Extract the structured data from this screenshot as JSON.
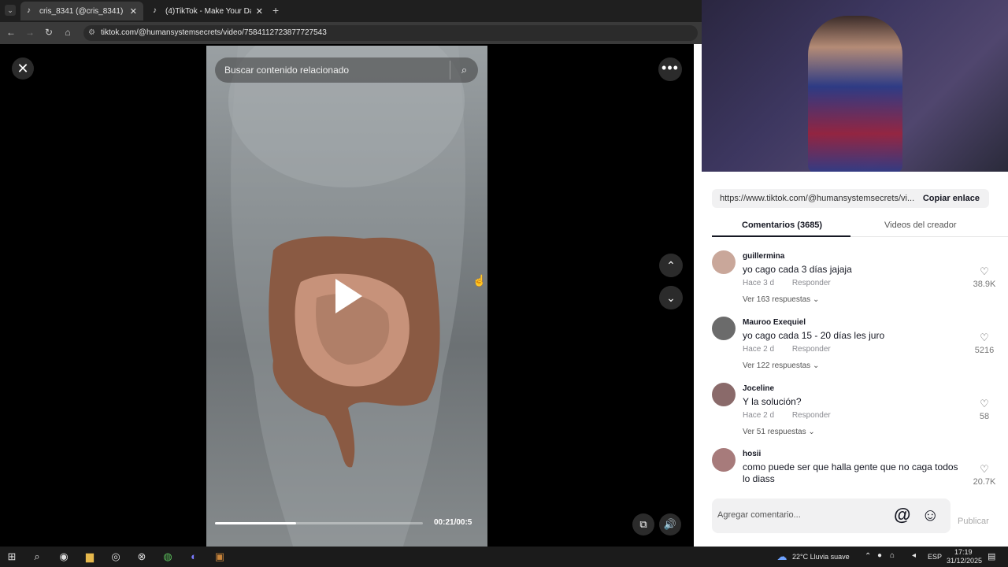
{
  "browser": {
    "tabs": [
      {
        "title": "cris_8341 (@cris_8341) | TikTok",
        "active": true
      },
      {
        "title": "(4)TikTok - Make Your Day",
        "active": false
      }
    ],
    "url": "tiktok.com/@humansystemsecrets/video/7584112723877727543"
  },
  "video": {
    "search_placeholder": "Buscar contenido relacionado",
    "time": "00:21/00:5",
    "progress": 0.39
  },
  "share": {
    "link": "https://www.tiktok.com/@humansystemsecrets/vi...",
    "copy_label": "Copiar enlace"
  },
  "tabs": {
    "comments": "Comentarios (3685)",
    "creator": "Videos del creador"
  },
  "comments": [
    {
      "user": "guillermina",
      "text": "yo cago cada 3 días jajaja",
      "time": "Hace 3 d",
      "reply": "Responder",
      "replies": "Ver 163 respuestas",
      "likes": "38.9K"
    },
    {
      "user": "Mauroo Exequiel",
      "text": "yo cago cada 15 - 20 días les juro",
      "time": "Hace 2 d",
      "reply": "Responder",
      "replies": "Ver 122 respuestas",
      "likes": "5216"
    },
    {
      "user": "Joceline",
      "text": "Y la solución?",
      "time": "Hace 2 d",
      "reply": "Responder",
      "replies": "Ver 51 respuestas",
      "likes": "58"
    },
    {
      "user": "hosii",
      "text": "como puede ser que halla gente que no caga todos lo diass",
      "time": "",
      "reply": "",
      "replies": "",
      "likes": "20.7K"
    }
  ],
  "composer": {
    "placeholder": "Agregar comentario...",
    "publish": "Publicar"
  },
  "taskbar": {
    "weather": "22°C  Lluvia suave",
    "lang": "ESP",
    "time": "17:19",
    "date": "31/12/2025"
  },
  "colors": {
    "accent": "#161823",
    "tiktok_pink": "#fe2c55"
  }
}
